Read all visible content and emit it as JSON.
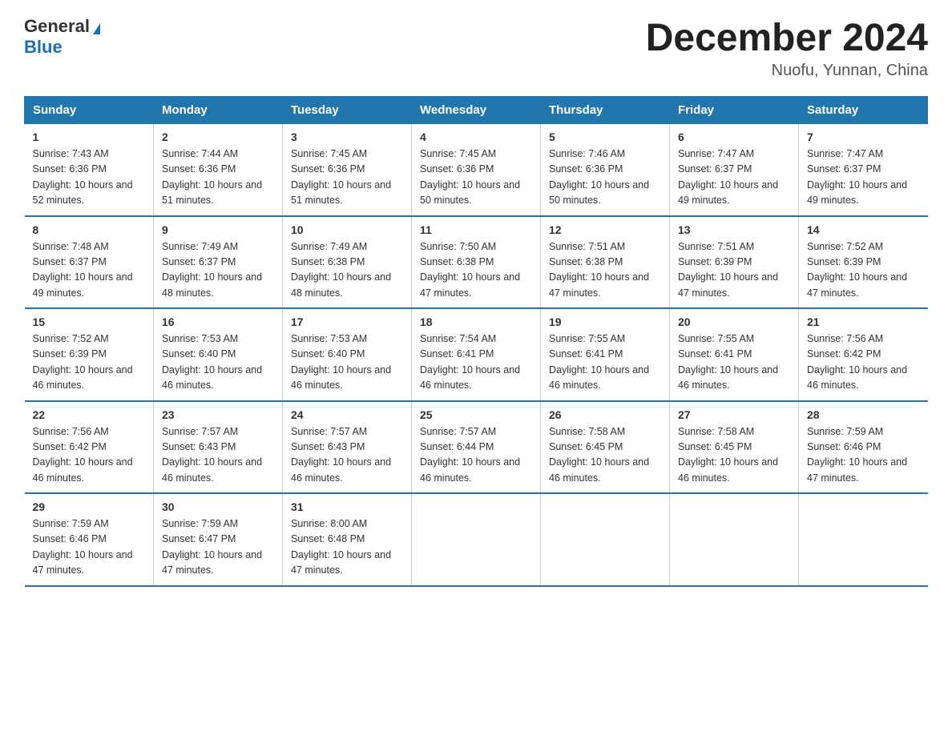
{
  "header": {
    "logo_general": "General",
    "logo_blue": "Blue",
    "month_title": "December 2024",
    "location": "Nuofu, Yunnan, China"
  },
  "days_of_week": [
    "Sunday",
    "Monday",
    "Tuesday",
    "Wednesday",
    "Thursday",
    "Friday",
    "Saturday"
  ],
  "weeks": [
    [
      {
        "day": "1",
        "sunrise": "7:43 AM",
        "sunset": "6:36 PM",
        "daylight": "10 hours and 52 minutes."
      },
      {
        "day": "2",
        "sunrise": "7:44 AM",
        "sunset": "6:36 PM",
        "daylight": "10 hours and 51 minutes."
      },
      {
        "day": "3",
        "sunrise": "7:45 AM",
        "sunset": "6:36 PM",
        "daylight": "10 hours and 51 minutes."
      },
      {
        "day": "4",
        "sunrise": "7:45 AM",
        "sunset": "6:36 PM",
        "daylight": "10 hours and 50 minutes."
      },
      {
        "day": "5",
        "sunrise": "7:46 AM",
        "sunset": "6:36 PM",
        "daylight": "10 hours and 50 minutes."
      },
      {
        "day": "6",
        "sunrise": "7:47 AM",
        "sunset": "6:37 PM",
        "daylight": "10 hours and 49 minutes."
      },
      {
        "day": "7",
        "sunrise": "7:47 AM",
        "sunset": "6:37 PM",
        "daylight": "10 hours and 49 minutes."
      }
    ],
    [
      {
        "day": "8",
        "sunrise": "7:48 AM",
        "sunset": "6:37 PM",
        "daylight": "10 hours and 49 minutes."
      },
      {
        "day": "9",
        "sunrise": "7:49 AM",
        "sunset": "6:37 PM",
        "daylight": "10 hours and 48 minutes."
      },
      {
        "day": "10",
        "sunrise": "7:49 AM",
        "sunset": "6:38 PM",
        "daylight": "10 hours and 48 minutes."
      },
      {
        "day": "11",
        "sunrise": "7:50 AM",
        "sunset": "6:38 PM",
        "daylight": "10 hours and 47 minutes."
      },
      {
        "day": "12",
        "sunrise": "7:51 AM",
        "sunset": "6:38 PM",
        "daylight": "10 hours and 47 minutes."
      },
      {
        "day": "13",
        "sunrise": "7:51 AM",
        "sunset": "6:39 PM",
        "daylight": "10 hours and 47 minutes."
      },
      {
        "day": "14",
        "sunrise": "7:52 AM",
        "sunset": "6:39 PM",
        "daylight": "10 hours and 47 minutes."
      }
    ],
    [
      {
        "day": "15",
        "sunrise": "7:52 AM",
        "sunset": "6:39 PM",
        "daylight": "10 hours and 46 minutes."
      },
      {
        "day": "16",
        "sunrise": "7:53 AM",
        "sunset": "6:40 PM",
        "daylight": "10 hours and 46 minutes."
      },
      {
        "day": "17",
        "sunrise": "7:53 AM",
        "sunset": "6:40 PM",
        "daylight": "10 hours and 46 minutes."
      },
      {
        "day": "18",
        "sunrise": "7:54 AM",
        "sunset": "6:41 PM",
        "daylight": "10 hours and 46 minutes."
      },
      {
        "day": "19",
        "sunrise": "7:55 AM",
        "sunset": "6:41 PM",
        "daylight": "10 hours and 46 minutes."
      },
      {
        "day": "20",
        "sunrise": "7:55 AM",
        "sunset": "6:41 PM",
        "daylight": "10 hours and 46 minutes."
      },
      {
        "day": "21",
        "sunrise": "7:56 AM",
        "sunset": "6:42 PM",
        "daylight": "10 hours and 46 minutes."
      }
    ],
    [
      {
        "day": "22",
        "sunrise": "7:56 AM",
        "sunset": "6:42 PM",
        "daylight": "10 hours and 46 minutes."
      },
      {
        "day": "23",
        "sunrise": "7:57 AM",
        "sunset": "6:43 PM",
        "daylight": "10 hours and 46 minutes."
      },
      {
        "day": "24",
        "sunrise": "7:57 AM",
        "sunset": "6:43 PM",
        "daylight": "10 hours and 46 minutes."
      },
      {
        "day": "25",
        "sunrise": "7:57 AM",
        "sunset": "6:44 PM",
        "daylight": "10 hours and 46 minutes."
      },
      {
        "day": "26",
        "sunrise": "7:58 AM",
        "sunset": "6:45 PM",
        "daylight": "10 hours and 46 minutes."
      },
      {
        "day": "27",
        "sunrise": "7:58 AM",
        "sunset": "6:45 PM",
        "daylight": "10 hours and 46 minutes."
      },
      {
        "day": "28",
        "sunrise": "7:59 AM",
        "sunset": "6:46 PM",
        "daylight": "10 hours and 47 minutes."
      }
    ],
    [
      {
        "day": "29",
        "sunrise": "7:59 AM",
        "sunset": "6:46 PM",
        "daylight": "10 hours and 47 minutes."
      },
      {
        "day": "30",
        "sunrise": "7:59 AM",
        "sunset": "6:47 PM",
        "daylight": "10 hours and 47 minutes."
      },
      {
        "day": "31",
        "sunrise": "8:00 AM",
        "sunset": "6:48 PM",
        "daylight": "10 hours and 47 minutes."
      },
      null,
      null,
      null,
      null
    ]
  ]
}
